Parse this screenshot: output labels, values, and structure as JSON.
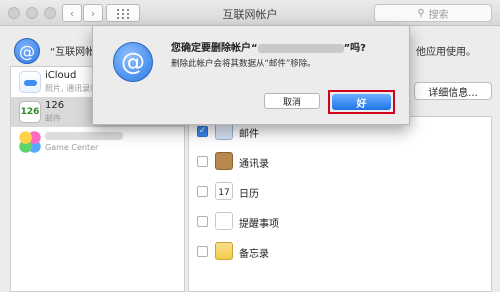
{
  "window": {
    "title": "互联网帐户"
  },
  "search": {
    "placeholder": "搜索"
  },
  "header": {
    "intro": "“互联网帐",
    "intro_right": "他应用使用。"
  },
  "accounts": [
    {
      "name": "iCloud",
      "subtitle": "照片, 通讯录和"
    },
    {
      "name": "126",
      "subtitle": "邮件"
    },
    {
      "name": "",
      "subtitle": "Game Center"
    }
  ],
  "details_button": "详细信息...",
  "services": [
    {
      "label": "邮件",
      "checked": true
    },
    {
      "label": "通讯录",
      "checked": false
    },
    {
      "label": "日历",
      "checked": false
    },
    {
      "label": "提醒事项",
      "checked": false
    },
    {
      "label": "备忘录",
      "checked": false
    }
  ],
  "dialog": {
    "title_prefix": "您确定要删除帐户“",
    "title_suffix": "”吗?",
    "message": "删除此帐户会将其数据从“邮件”移除。",
    "cancel_label": "取消",
    "ok_label": "好"
  },
  "colors": {
    "accent": "#1f73ea",
    "highlight": "#d0021b"
  }
}
